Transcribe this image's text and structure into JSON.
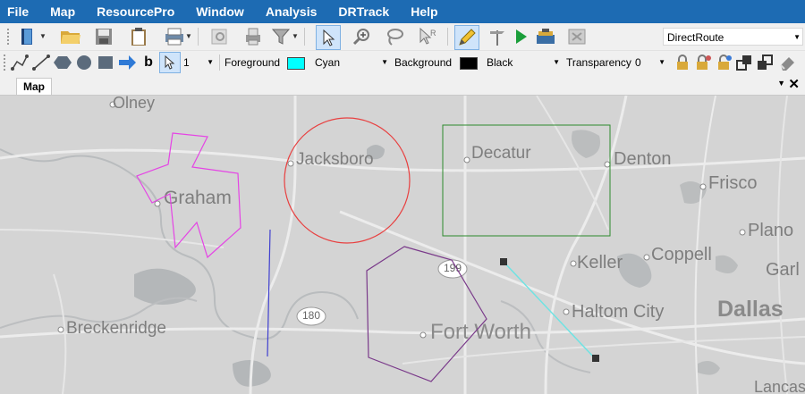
{
  "menu": [
    "File",
    "Map",
    "ResourcePro",
    "Window",
    "Analysis",
    "DRTrack",
    "Help"
  ],
  "toolbar1": {
    "icons": [
      "book-icon",
      "open-folder-icon",
      "save-icon",
      "clipboard-icon",
      "print-icon",
      "print-preview-icon",
      "print-stack-icon",
      "filter-icon",
      "select-arrow-icon",
      "zoom-in-icon",
      "lasso-icon",
      "pick-arrow-icon",
      "pencil-icon",
      "signpost-icon",
      "run-icon",
      "toolbox-icon",
      "cancel-grid-icon"
    ],
    "route_value": "DirectRoute"
  },
  "toolbar2": {
    "line_width": "1",
    "foreground_label": "Foreground",
    "foreground_value": "Cyan",
    "foreground_color": "#00ffff",
    "background_label": "Background",
    "background_value": "Black",
    "background_color": "#000000",
    "transparency_label": "Transparency",
    "transparency_value": "0"
  },
  "tabs": {
    "active": "Map",
    "close_symbol": "✕",
    "dropdown_symbol": "▼"
  },
  "map": {
    "cities": [
      {
        "name": "Olney"
      },
      {
        "name": "Jacksboro"
      },
      {
        "name": "Decatur"
      },
      {
        "name": "Denton"
      },
      {
        "name": "Frisco"
      },
      {
        "name": "Graham"
      },
      {
        "name": "Plano"
      },
      {
        "name": "Keller"
      },
      {
        "name": "Coppell"
      },
      {
        "name": "Garl"
      },
      {
        "name": "Haltom City"
      },
      {
        "name": "Dallas"
      },
      {
        "name": "Breckenridge"
      },
      {
        "name": "Fort Worth"
      },
      {
        "name": "Lancast"
      }
    ],
    "highway_labels": [
      "199",
      "180"
    ]
  }
}
